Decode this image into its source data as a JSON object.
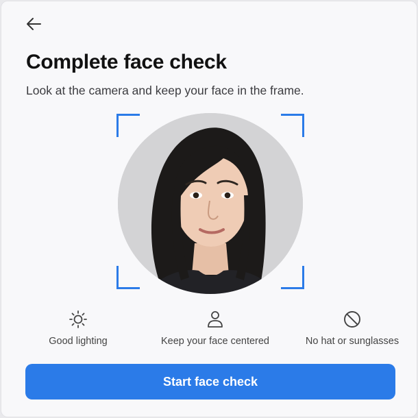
{
  "header": {
    "back_icon": "arrow-left-icon",
    "title": "Complete face check",
    "subtitle": "Look at the camera and keep your face in the frame."
  },
  "camera": {
    "frame_color": "#2b7be8"
  },
  "tips": [
    {
      "icon": "sun-icon",
      "label": "Good lighting"
    },
    {
      "icon": "person-icon",
      "label": "Keep your face centered"
    },
    {
      "icon": "no-symbol-icon",
      "label": "No hat or sunglasses"
    }
  ],
  "actions": {
    "start_label": "Start face check"
  },
  "colors": {
    "accent": "#2b7be8",
    "background": "#f8f8fa",
    "title": "#111111"
  }
}
